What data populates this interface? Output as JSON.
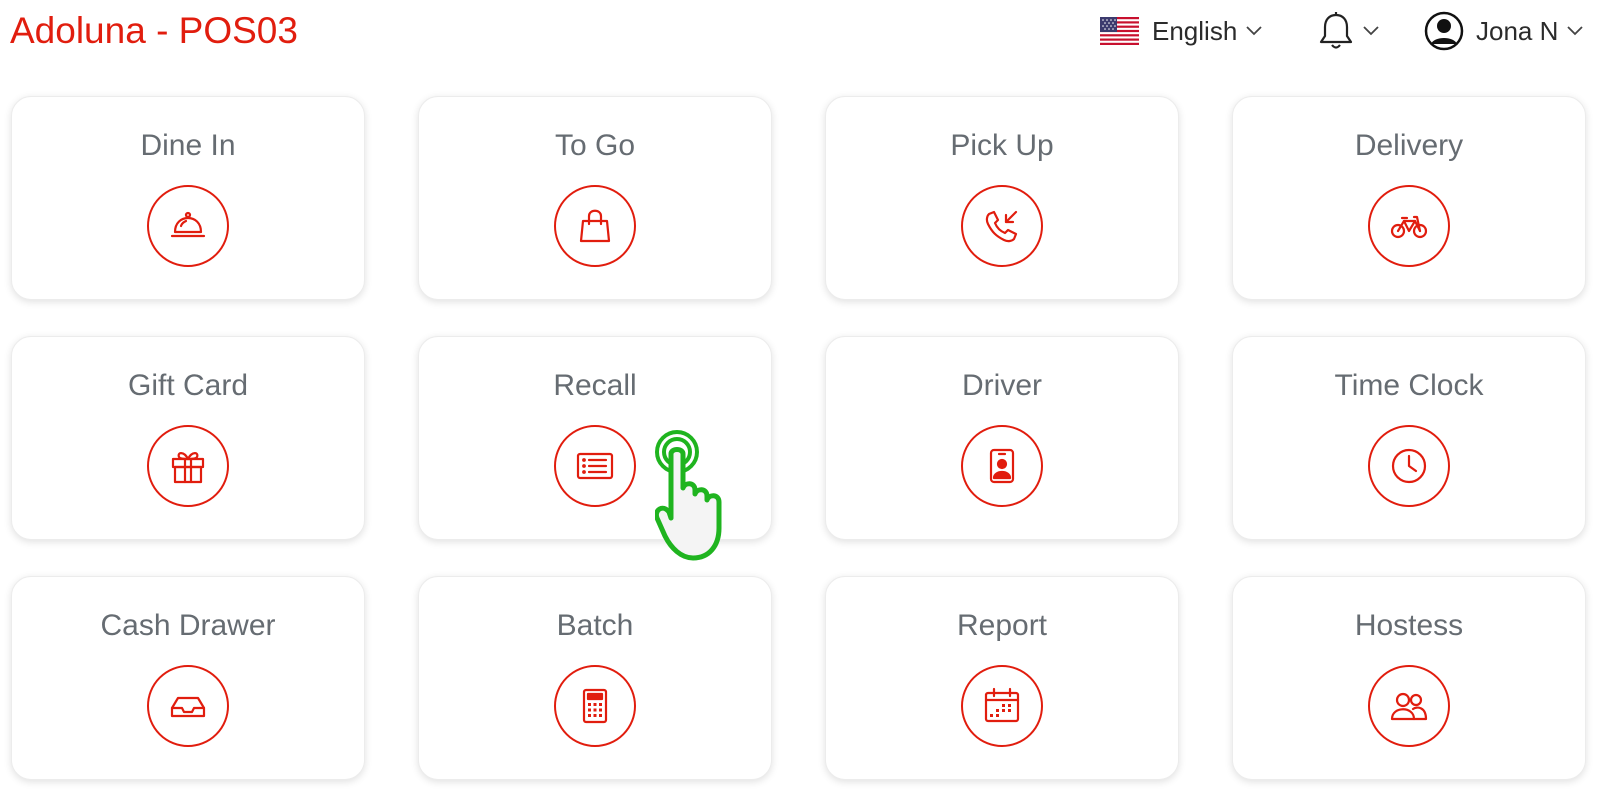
{
  "header": {
    "title": "Adoluna - POS03",
    "language": "English",
    "language_flag_icon": "us-flag-icon",
    "notifications_icon": "bell-icon",
    "user_name": "Jona N",
    "user_icon": "user-circle-icon"
  },
  "colors": {
    "accent": "#e11d0e",
    "label": "#666c72",
    "text": "#2b2b2b",
    "cursor": "#1fb41f"
  },
  "tiles": [
    {
      "label": "Dine In",
      "icon": "food-cloche-icon"
    },
    {
      "label": "To Go",
      "icon": "shopping-bag-icon"
    },
    {
      "label": "Pick Up",
      "icon": "incoming-call-icon"
    },
    {
      "label": "Delivery",
      "icon": "bicycle-icon"
    },
    {
      "label": "Gift Card",
      "icon": "gift-icon"
    },
    {
      "label": "Recall",
      "icon": "receipt-list-icon"
    },
    {
      "label": "Driver",
      "icon": "id-badge-icon"
    },
    {
      "label": "Time Clock",
      "icon": "clock-icon"
    },
    {
      "label": "Cash Drawer",
      "icon": "inbox-tray-icon"
    },
    {
      "label": "Batch",
      "icon": "calculator-icon"
    },
    {
      "label": "Report",
      "icon": "calendar-icon"
    },
    {
      "label": "Hostess",
      "icon": "users-icon"
    }
  ],
  "pointer": {
    "icon": "tap-hand-icon",
    "target": "Recall"
  }
}
